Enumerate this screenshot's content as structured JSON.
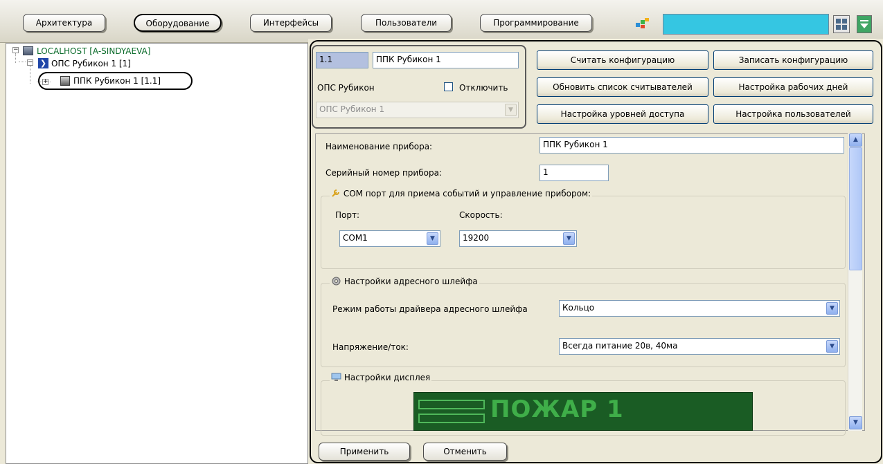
{
  "toolbar": {
    "tabs": [
      {
        "label": "Архитектура"
      },
      {
        "label": "Оборудование"
      },
      {
        "label": "Интерфейсы"
      },
      {
        "label": "Пользователи"
      },
      {
        "label": "Программирование"
      }
    ],
    "accent_field_color": "#35c6e2"
  },
  "tree": {
    "host": "LOCALHOST [A-SINDYAEVA]",
    "ops": "ОПС Рубикон 1 [1]",
    "ppk": "ППК Рубикон 1 [1.1]"
  },
  "ident": {
    "id": "1.1",
    "name": "ППК Рубикон 1",
    "parent_type": "ОПС Рубикон",
    "disable_label": "Отключить",
    "parent_select": "ОПС Рубикон 1"
  },
  "actions": {
    "read_config": "Считать конфигурацию",
    "write_config": "Записать конфигурацию",
    "update_readers": "Обновить список считывателей",
    "workdays": "Настройка рабочих дней",
    "access_levels": "Настройка уровней доступа",
    "users": "Настройка пользователей"
  },
  "settings": {
    "device_name_label": "Наименование прибора:",
    "device_name_value": "ППК Рубикон 1",
    "serial_label": "Серийный номер прибора:",
    "serial_value": "1",
    "com_group_title": "COM порт для приема событий и управление прибором:",
    "port_label": "Порт:",
    "port_value": "COM1",
    "speed_label": "Скорость:",
    "speed_value": "19200",
    "loop_group_title": "Настройки адресного шлейфа",
    "loop_mode_label": "Режим работы драйвера адресного шлейфа",
    "loop_mode_value": "Кольцо",
    "voltage_label": "Напряжение/ток:",
    "voltage_value": "Всегда питание 20в, 40ма",
    "display_group_title": "Настройки дисплея",
    "display_text": "ПОЖАР 1"
  },
  "footer": {
    "apply": "Применить",
    "cancel": "Отменить"
  }
}
